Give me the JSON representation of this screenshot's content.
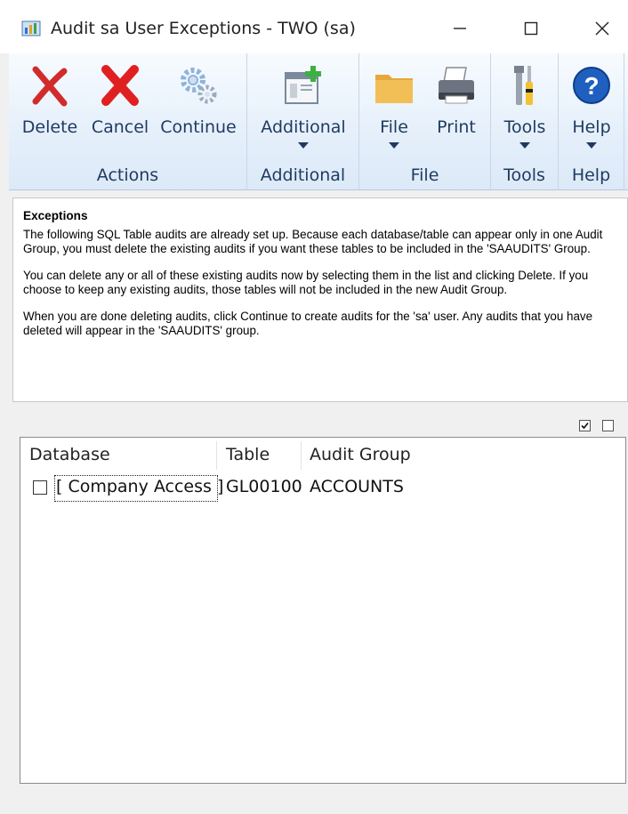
{
  "window": {
    "title": "Audit sa User Exceptions  -  TWO (sa)",
    "minimize_glyph": "minimize-icon",
    "maximize_glyph": "maximize-icon",
    "close_glyph": "close-icon"
  },
  "ribbon": {
    "groups": [
      {
        "label": "Actions",
        "buttons": [
          "Delete",
          "Cancel",
          "Continue"
        ]
      },
      {
        "label": "Additional",
        "buttons": [
          "Additional"
        ]
      },
      {
        "label": "File",
        "buttons": [
          "File",
          "Print"
        ]
      },
      {
        "label": "Tools",
        "buttons": [
          "Tools"
        ]
      },
      {
        "label": "Help",
        "buttons": [
          "Help"
        ]
      }
    ]
  },
  "info": {
    "heading": "Exceptions",
    "para1": "The following SQL Table audits are already set up.  Because each database/table can appear only in one Audit Group, you must delete the existing audits if you want these tables to be included in the 'SAAUDITS' Group.",
    "para2": "You can delete any or all of these existing audits now by selecting them in the list and clicking Delete.  If you choose to keep any existing audits, those tables will not be included in the new Audit Group.",
    "para3": "When you are done deleting audits, click Continue to create audits for the 'sa' user.  Any audits that you have deleted will appear in the 'SAAUDITS' group."
  },
  "list": {
    "columns": [
      "Database",
      "Table",
      "Audit Group"
    ],
    "rows": [
      {
        "checked": false,
        "database": "[ Company Access ]",
        "table": "GL00100",
        "audit_group": "ACCOUNTS"
      }
    ]
  },
  "colors": {
    "ribbon_text": "#1f3a5f",
    "delete_x": "#d22b2b",
    "cancel_x": "#e02020",
    "help_blue": "#1f5fbf"
  }
}
